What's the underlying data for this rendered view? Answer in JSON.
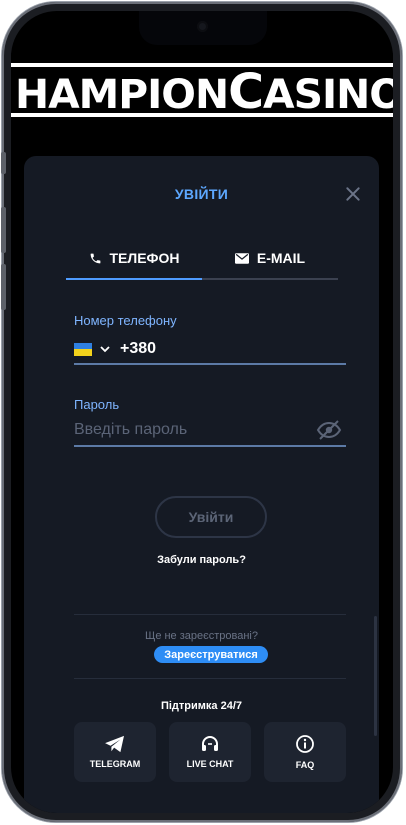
{
  "logo": {
    "text_1": "HAMPION",
    "text_2": "C",
    "text_3": "ASINO"
  },
  "modal": {
    "title": "УВІЙТИ",
    "tabs": [
      {
        "label": "ТЕЛЕФОН",
        "icon": "phone-icon",
        "active": true
      },
      {
        "label": "E-MAIL",
        "icon": "mail-icon",
        "active": false
      }
    ],
    "phone": {
      "label": "Номер телефону",
      "country_flag": "ukraine-flag",
      "prefix": "+380"
    },
    "password": {
      "label": "Пароль",
      "placeholder": "Введіть пароль"
    },
    "login_button": "Увійти",
    "forgot": "Забули пароль?",
    "not_registered": "Ще не зареєстровані?",
    "register_button": "Зареєструватися",
    "support_title": "Підтримка 24/7",
    "support": [
      {
        "label": "TELEGRAM",
        "icon": "telegram-icon"
      },
      {
        "label": "LIVE CHAT",
        "icon": "headset-icon"
      },
      {
        "label": "FAQ",
        "icon": "info-icon"
      }
    ]
  },
  "colors": {
    "accent": "#4f9cff",
    "title": "#5da8ff",
    "panel": "#151a24",
    "register": "#2e8df5"
  }
}
